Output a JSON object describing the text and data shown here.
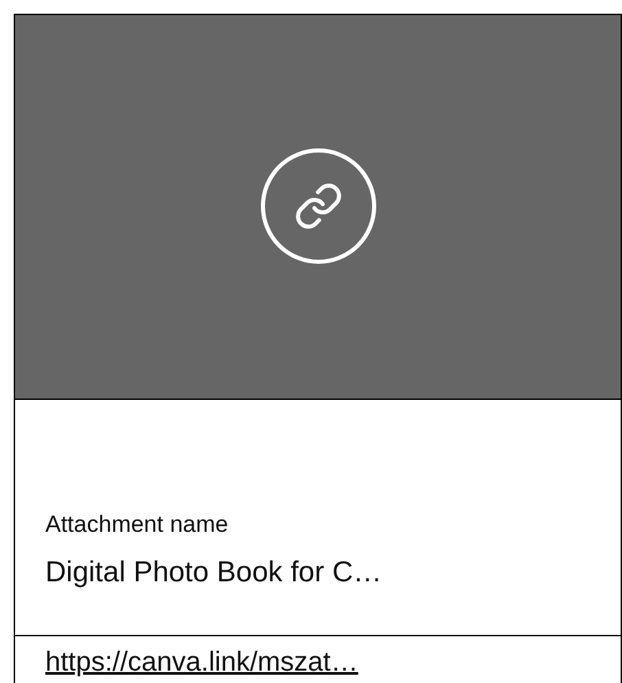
{
  "attachment": {
    "label": "Attachment name",
    "name": "Digital Photo Book for C…"
  },
  "link": {
    "text": "https://canva.link/mszat…"
  }
}
